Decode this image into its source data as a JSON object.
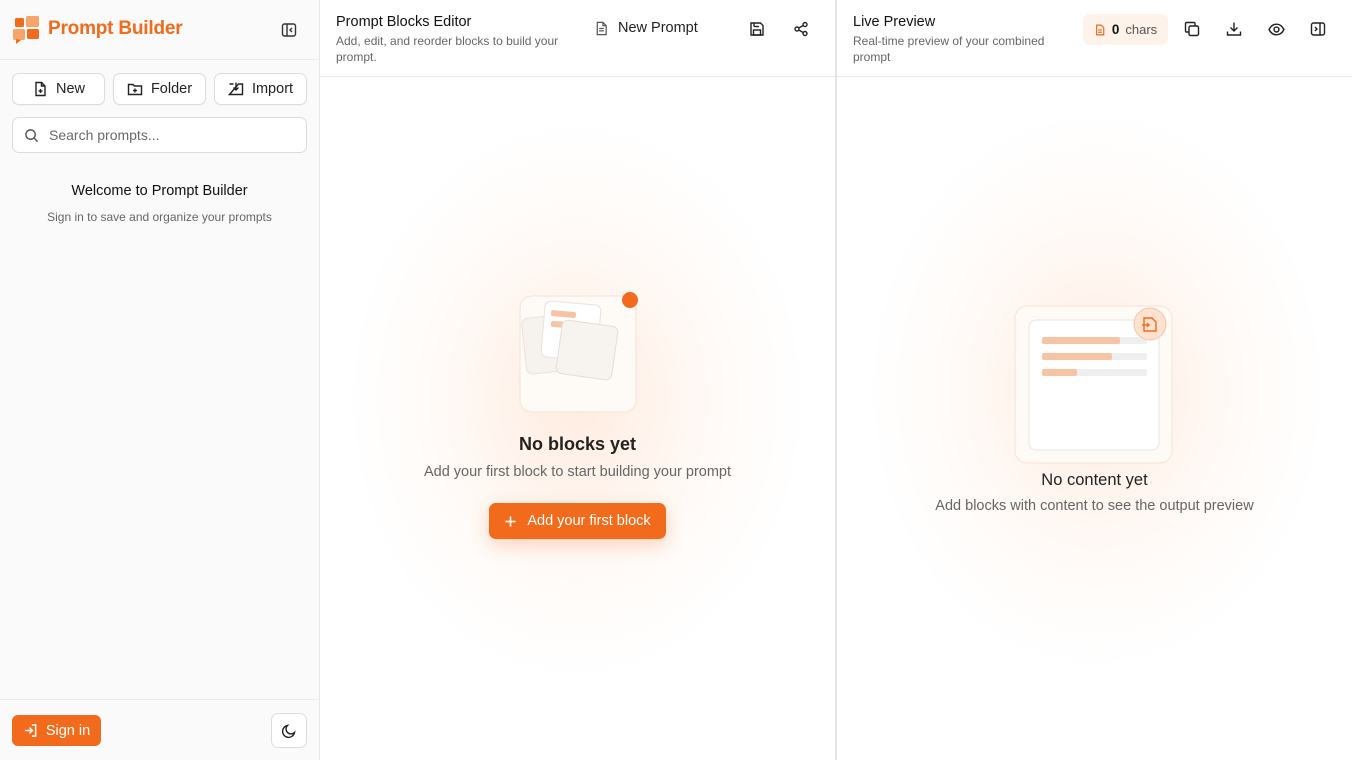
{
  "sidebar": {
    "brand": "Prompt Builder",
    "actions": {
      "new_label": "New",
      "folder_label": "Folder",
      "import_label": "Import"
    },
    "search": {
      "placeholder": "Search prompts..."
    },
    "welcome": {
      "title": "Welcome to Prompt Builder",
      "subtitle": "Sign in to save and organize your prompts"
    },
    "footer": {
      "signin_label": "Sign in"
    }
  },
  "editor": {
    "title": "Prompt Blocks Editor",
    "subtitle": "Add, edit, and reorder blocks to build your prompt.",
    "doc_name": "New Prompt",
    "empty_title": "No blocks yet",
    "empty_subtitle": "Add your first block to start building your prompt",
    "add_button": "Add your first block"
  },
  "preview": {
    "title": "Live Preview",
    "subtitle": "Real-time preview of your combined prompt",
    "char_count": "0",
    "char_unit": "chars",
    "empty_title": "No content yet",
    "empty_subtitle": "Add blocks with content to see the output preview"
  },
  "colors": {
    "accent": "#f26a1b",
    "accent_light": "#f6c4a4",
    "badge_bg": "#fdf3ea"
  },
  "icons": [
    "logo-icon",
    "sidebar-collapse-icon",
    "file-plus-icon",
    "folder-plus-icon",
    "import-icon",
    "search-icon",
    "sign-in-icon",
    "moon-icon",
    "document-icon",
    "save-icon",
    "share-icon",
    "copy-icon",
    "download-icon",
    "eye-icon",
    "panel-right-icon",
    "plus-icon"
  ]
}
